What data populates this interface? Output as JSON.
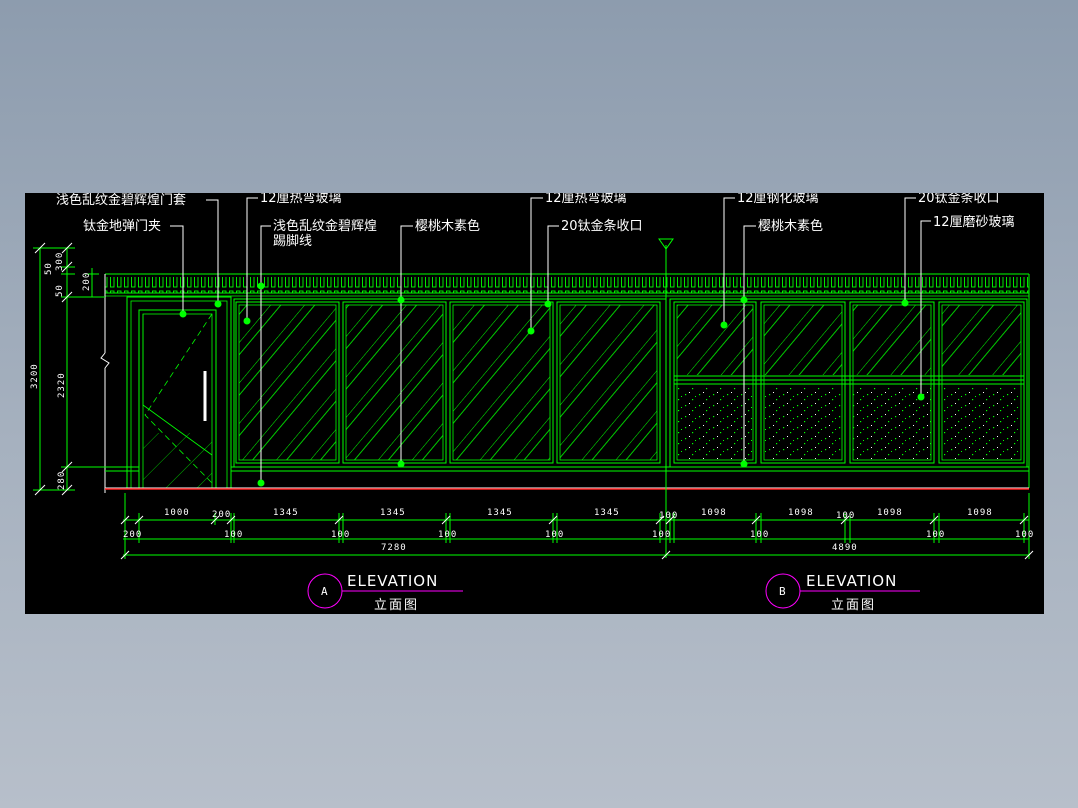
{
  "colors": {
    "line": "#00ff00",
    "text": "#ffffff",
    "floor": "#ff2020",
    "callout": "#ff00ff",
    "background": "#000000"
  },
  "labels": {
    "door_frame": "浅色乱纹金碧辉煌门套",
    "floor_hinge": "钛金地弹门夹",
    "curved_glass_1": "12厘热弯玻璃",
    "baseboard_line1": "浅色乱纹金碧辉煌",
    "baseboard_line2": "踢脚线",
    "cherry_wood_1": "樱桃木素色",
    "curved_glass_2": "12厘热弯玻璃",
    "titanium_strip_1": "20钛金条收口",
    "tempered_glass": "12厘钢化玻璃",
    "cherry_wood_2": "樱桃木素色",
    "titanium_strip_2": "20钛金条收口",
    "frosted_glass": "12厘磨砂玻璃"
  },
  "vertical_dims": {
    "top_300": "300",
    "top_50a": "50",
    "top_50b": "50",
    "top_200": "200",
    "total": "3200",
    "mid": "2320",
    "bottom": "280"
  },
  "dims_upper": [
    "1000",
    "200",
    "1345",
    "1345",
    "1345",
    "1345",
    "100",
    "1098",
    "1098",
    "100",
    "1098",
    "1098"
  ],
  "dims_lower": [
    "200",
    "100",
    "100",
    "100",
    "100",
    "100",
    "100",
    "100",
    "100"
  ],
  "totals": {
    "a": "7280",
    "b": "4890"
  },
  "titles": {
    "a": {
      "letter": "A",
      "title": "ELEVATION",
      "subtitle": "立面图"
    },
    "b": {
      "letter": "B",
      "title": "ELEVATION",
      "subtitle": "立面图"
    }
  }
}
